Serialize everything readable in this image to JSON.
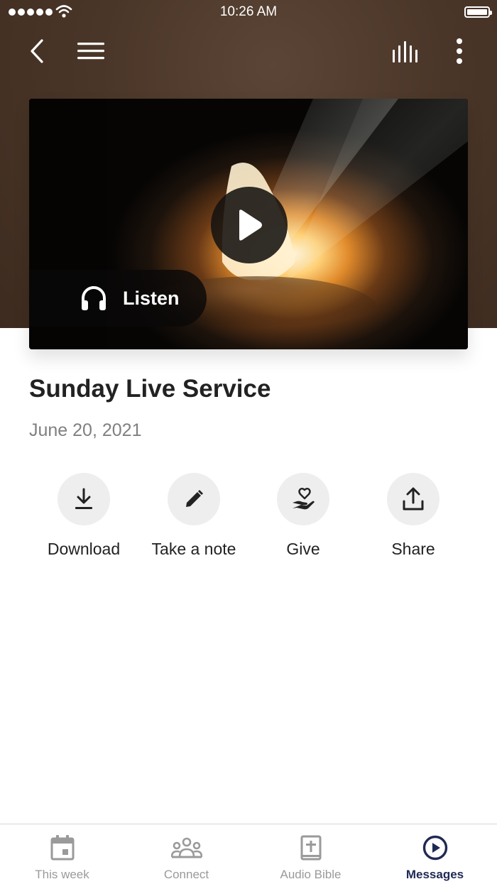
{
  "status_bar": {
    "time": "10:26 AM"
  },
  "header": {
    "back_icon": "chevron-left-icon",
    "menu_icon": "hamburger-menu-icon",
    "audio_icon": "audio-bars-icon",
    "more_icon": "more-vertical-icon"
  },
  "media": {
    "play_icon": "play-icon",
    "listen_label": "Listen",
    "listen_icon": "headphones-icon"
  },
  "content": {
    "title": "Sunday Live Service",
    "date": "June 20, 2021"
  },
  "actions": [
    {
      "label": "Download",
      "icon": "download-icon"
    },
    {
      "label": "Take a note",
      "icon": "pencil-icon"
    },
    {
      "label": "Give",
      "icon": "heart-hand-icon"
    },
    {
      "label": "Share",
      "icon": "share-icon"
    }
  ],
  "tabbar": {
    "tabs": [
      {
        "label": "This week",
        "icon": "calendar-icon",
        "active": false
      },
      {
        "label": "Connect",
        "icon": "group-icon",
        "active": false
      },
      {
        "label": "Audio Bible",
        "icon": "bible-icon",
        "active": false
      },
      {
        "label": "Messages",
        "icon": "play-circle-icon",
        "active": true
      }
    ]
  },
  "colors": {
    "header_brown": "#4a3628",
    "active_tab": "#1f2a53",
    "inactive_tab": "#9a9a9a",
    "action_circle": "#eeeeee"
  }
}
